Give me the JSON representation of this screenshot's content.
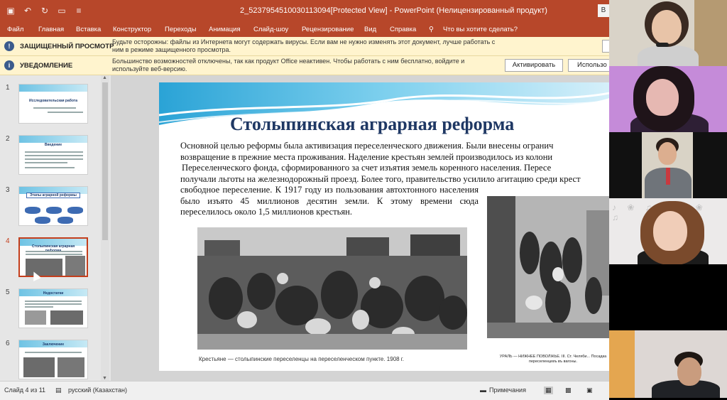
{
  "window": {
    "title": "2_5237954510030113094[Protected View]  -  PowerPoint (Нелицензированный продукт)",
    "right_button": "В"
  },
  "quick_access": [
    "save-icon",
    "undo-icon",
    "redo-icon",
    "slideshow-icon",
    "more-icon"
  ],
  "ribbon": {
    "tabs": [
      "Файл",
      "Главная",
      "Вставка",
      "Конструктор",
      "Переходы",
      "Анимация",
      "Слайд-шоу",
      "Рецензирование",
      "Вид",
      "Справка"
    ],
    "tell_me": "Что вы хотите сделать?"
  },
  "protected_bar": {
    "label": "ЗАЩИЩЕННЫЙ ПРОСМОТР",
    "message": "Будьте осторожны: файлы из Интернета могут содержать вирусы. Если вам не нужно изменять этот документ, лучше работать с ним в режиме защищенного просмотра."
  },
  "notice_bar": {
    "label": "УВЕДОМЛЕНИЕ",
    "message": "Большинство возможностей отключены, так как продукт Office неактивен. Чтобы работать с ним бесплатно, войдите и используйте веб-версию.",
    "activate_label": "Активировать",
    "use_label": "Использо"
  },
  "thumbnails": [
    {
      "num": "1",
      "title": "Исследовательская работа"
    },
    {
      "num": "2",
      "title": "Введение"
    },
    {
      "num": "3",
      "title": "Этапы аграрной реформы"
    },
    {
      "num": "4",
      "title": "Столыпинская аграрная реформа"
    },
    {
      "num": "5",
      "title": "Недостатки"
    },
    {
      "num": "6",
      "title": "Заключение"
    }
  ],
  "slide": {
    "title": "Столыпинская аграрная реформа",
    "lines_full": [
      "Основной целью реформы была активизация переселенческого движения. Были внесены огранич",
      "возвращение в прежние места проживания. Наделение крестьян землей производилось из колони",
      "Переселенческого фонда, сформированного за счет изъятия земель коренного населения. Пересе",
      "получали льготы на железнодорожный проезд. Более того, правительство усилило агитацию среди крест"
    ],
    "narrow_text": "свободное переселение. К 1917 году из пользования автохтонного населения было изъято 45 миллионов десятин земли. К этому времени сюда переселилось около 1,5 миллионов крестьян.",
    "caption_left": "Крестьяне — столыпинские переселенцы на переселенческом пункте. 1908 г.",
    "caption_right": "УРАЛЬ — НИЖНЕЕ ПОВОЛЖЬЕ. III. Ст. Челяби... Посадка переселенцевъ въ вагоны."
  },
  "status": {
    "slide_info": "Слайд 4 из 11",
    "language": "русский (Казахстан)",
    "notes_label": "Примечания"
  },
  "participants": [
    {
      "name": "participant-1"
    },
    {
      "name": "participant-2"
    },
    {
      "name": "participant-3"
    },
    {
      "name": "participant-4"
    },
    {
      "name": "participant-5"
    },
    {
      "name": "participant-6"
    }
  ]
}
